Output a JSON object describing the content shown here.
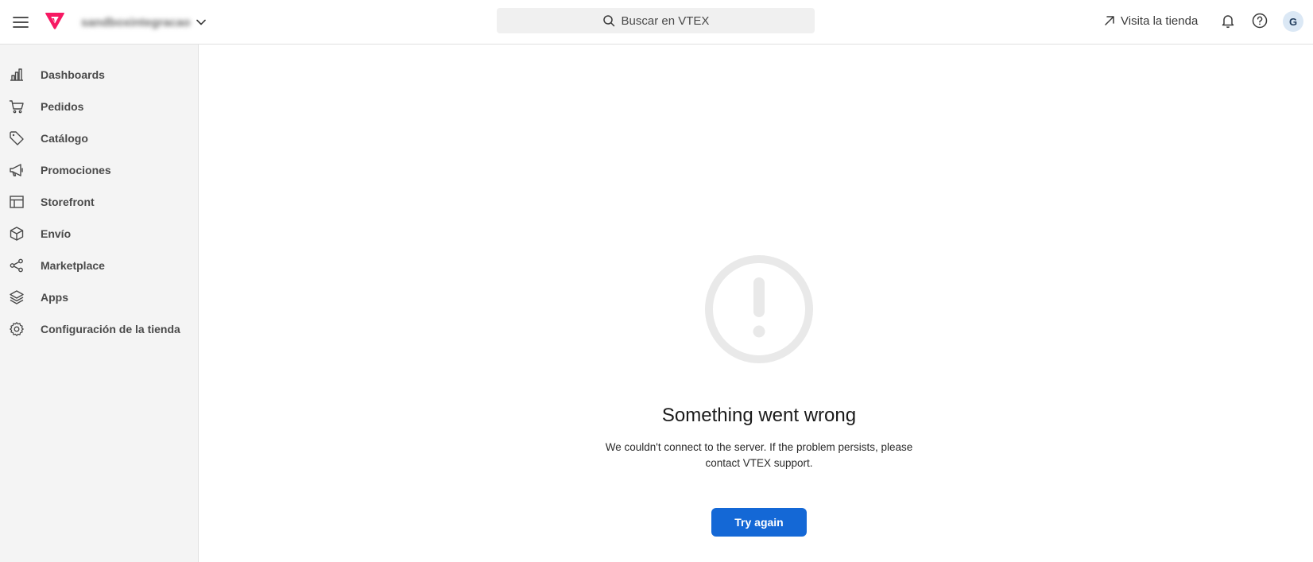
{
  "header": {
    "account_name": "sandboxintegracao",
    "search_placeholder": "Buscar en VTEX",
    "visit_store_label": "Visita la tienda",
    "avatar_initial": "G",
    "brand_color": "#f71963"
  },
  "sidebar": {
    "items": [
      {
        "label": "Dashboards",
        "icon": "bar-chart-icon"
      },
      {
        "label": "Pedidos",
        "icon": "cart-icon"
      },
      {
        "label": "Catálogo",
        "icon": "tag-icon"
      },
      {
        "label": "Promociones",
        "icon": "megaphone-icon"
      },
      {
        "label": "Storefront",
        "icon": "layout-icon"
      },
      {
        "label": "Envío",
        "icon": "box-icon"
      },
      {
        "label": "Marketplace",
        "icon": "share-icon"
      },
      {
        "label": "Apps",
        "icon": "layers-icon"
      },
      {
        "label": "Configuración de la tienda",
        "icon": "gear-icon"
      }
    ]
  },
  "error": {
    "title": "Something went wrong",
    "message": "We couldn't connect to the server. If the problem persists, please contact VTEX support.",
    "button_label": "Try again",
    "button_color": "#1468d6"
  }
}
